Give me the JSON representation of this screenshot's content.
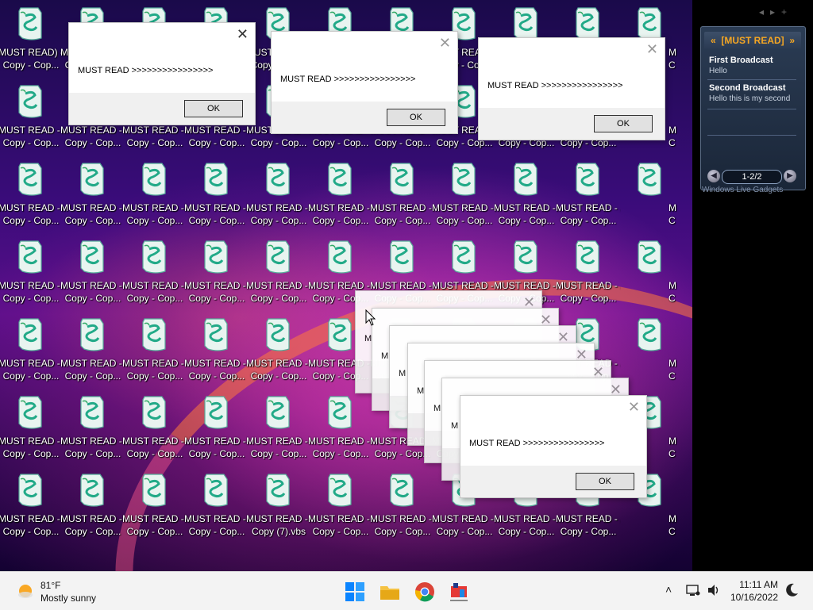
{
  "desktop": {
    "icon_label_line1": "MUST READ - ...",
    "icon_label_line2": "Copy - Cop...",
    "icon_label_first_line1": "MUST READ) - ",
    "icon_label_first_line2": "Copy - Cop...",
    "special_icon_label_line2": "Copy (7).vbs",
    "right_col_line1": "M",
    "right_col_line2": "C"
  },
  "dialogs": {
    "message": "MUST READ >>>>>>>>>>>>>>>>",
    "ok_label": "OK",
    "close_glyph": "✕",
    "stub_letter": "M"
  },
  "gadget": {
    "title": "[MUST READ]",
    "items": [
      {
        "title": "First Broadcast",
        "subtitle": "Hello"
      },
      {
        "title": "Second Broadcast",
        "subtitle": "Hello this is my second"
      }
    ],
    "pager": "1-2/2",
    "footer": "Windows Live Gadgets"
  },
  "taskbar": {
    "weather_temp": "81°F",
    "weather_desc": "Mostly sunny",
    "time": "11:11 AM",
    "date": "10/16/2022"
  },
  "colors": {
    "accent": "#f5a623",
    "taskbar": "#f3f3f3",
    "dialog_footer": "#f0f0f0"
  }
}
